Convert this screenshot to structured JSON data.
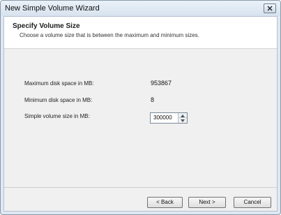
{
  "window": {
    "title": "New Simple Volume Wizard"
  },
  "header": {
    "title": "Specify Volume Size",
    "subtitle": "Choose a volume size that is between the maximum and minimum sizes."
  },
  "fields": {
    "max_label": "Maximum disk space in MB:",
    "max_value": "953867",
    "min_label": "Minimum disk space in MB:",
    "min_value": "8",
    "size_label": "Simple volume size in MB:",
    "size_value": "300000"
  },
  "buttons": {
    "back": "< Back",
    "next": "Next >",
    "cancel": "Cancel"
  }
}
